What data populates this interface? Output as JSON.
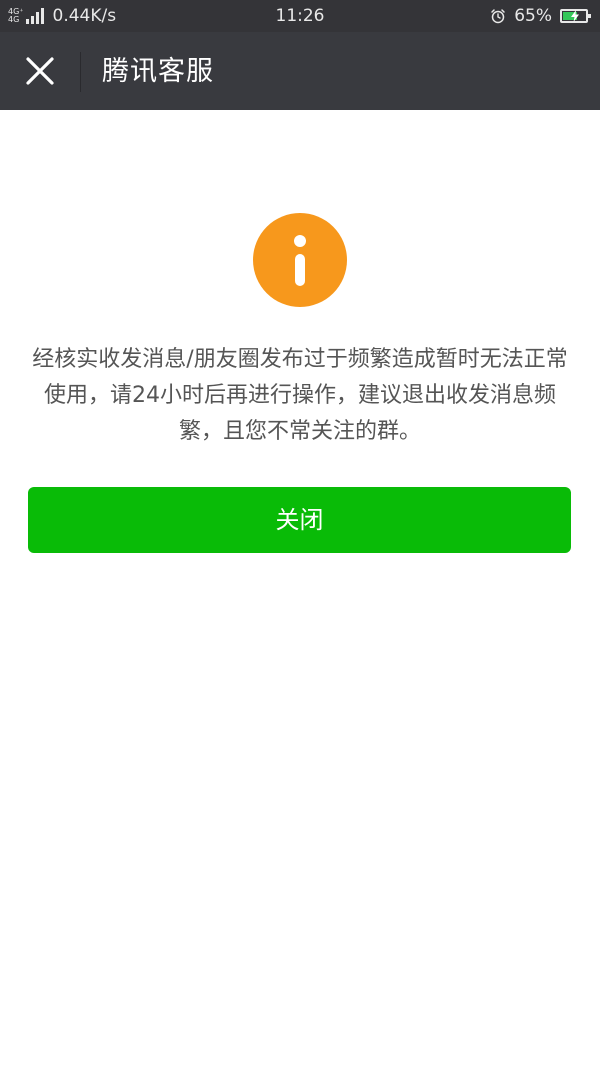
{
  "status_bar": {
    "network_type_1": "4G⁺",
    "network_type_2": "4G",
    "network_speed": "0.44K/s",
    "time": "11:26",
    "battery_percent": "65%",
    "battery_level": 0.65,
    "icons": [
      "signal-icon",
      "alarm-icon",
      "battery-icon",
      "charging-bolt-icon"
    ]
  },
  "title_bar": {
    "title": "腾讯客服",
    "close_icon": "close-icon"
  },
  "alert": {
    "icon": "info-icon",
    "icon_color": "#f7981c",
    "message": "经核实收发消息/朋友圈发布过于频繁造成暂时无法正常使用，请24小时后再进行操作，建议退出收发消息频繁，且您不常关注的群。"
  },
  "actions": {
    "close_label": "关闭",
    "button_color": "#09bb07"
  }
}
